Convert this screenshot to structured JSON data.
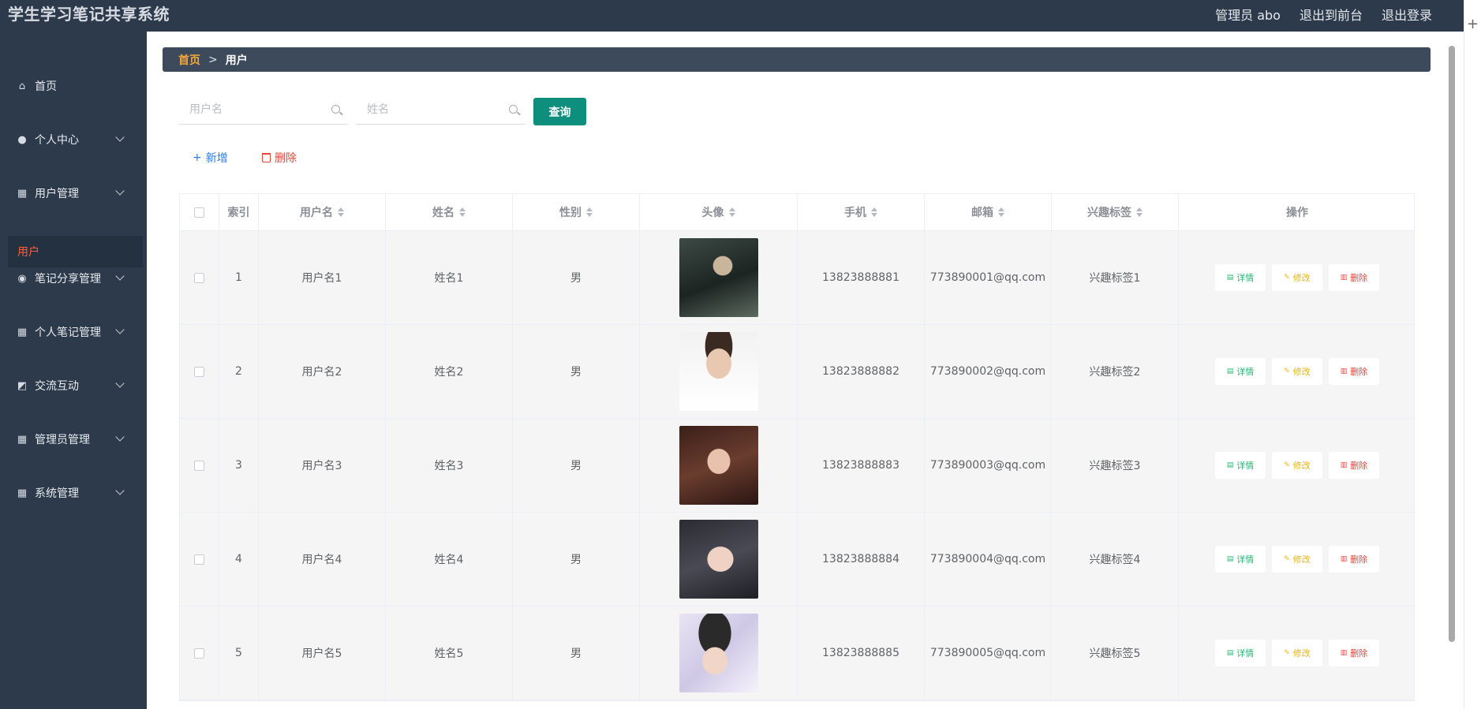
{
  "app": {
    "title": "学生学习笔记共享系统",
    "user_label": "管理员 abo",
    "to_front_label": "退出到前台",
    "logout_label": "退出登录"
  },
  "sidebar": {
    "items": [
      {
        "label": "首页",
        "icon": "home-icon",
        "has_children": false
      },
      {
        "label": "个人中心",
        "icon": "user-icon",
        "has_children": true
      },
      {
        "label": "用户管理",
        "icon": "grid-icon",
        "has_children": true
      },
      {
        "label": "笔记分享管理",
        "icon": "bulb-icon",
        "has_children": true
      },
      {
        "label": "个人笔记管理",
        "icon": "grid-icon",
        "has_children": true
      },
      {
        "label": "交流互动",
        "icon": "chart-icon",
        "has_children": true
      },
      {
        "label": "管理员管理",
        "icon": "grid-icon",
        "has_children": true
      },
      {
        "label": "系统管理",
        "icon": "grid-icon",
        "has_children": true
      }
    ],
    "active_sub": "用户"
  },
  "breadcrumb": {
    "home": "首页",
    "separator": ">",
    "current": "用户"
  },
  "search": {
    "username_placeholder": "用户名",
    "name_placeholder": "姓名",
    "query_label": "查询"
  },
  "actions": {
    "add_label": "新增",
    "delete_label": "删除"
  },
  "table": {
    "headers": [
      "索引",
      "用户名",
      "姓名",
      "性别",
      "头像",
      "手机",
      "邮箱",
      "兴趣标签",
      "操作"
    ],
    "rows": [
      {
        "index": "1",
        "username": "用户名1",
        "name": "姓名1",
        "sex": "男",
        "phone": "13823888881",
        "email": "773890001@qq.com",
        "tag": "兴趣标签1"
      },
      {
        "index": "2",
        "username": "用户名2",
        "name": "姓名2",
        "sex": "男",
        "phone": "13823888882",
        "email": "773890002@qq.com",
        "tag": "兴趣标签2"
      },
      {
        "index": "3",
        "username": "用户名3",
        "name": "姓名3",
        "sex": "男",
        "phone": "13823888883",
        "email": "773890003@qq.com",
        "tag": "兴趣标签3"
      },
      {
        "index": "4",
        "username": "用户名4",
        "name": "姓名4",
        "sex": "男",
        "phone": "13823888884",
        "email": "773890004@qq.com",
        "tag": "兴趣标签4"
      },
      {
        "index": "5",
        "username": "用户名5",
        "name": "姓名5",
        "sex": "男",
        "phone": "13823888885",
        "email": "773890005@qq.com",
        "tag": "兴趣标签5"
      }
    ],
    "op_labels": {
      "detail": "详情",
      "edit": "修改",
      "delete": "删除"
    }
  },
  "colors": {
    "sidebar_bg": "#2d3a4b",
    "accent_teal": "#0e8f7e",
    "breadcrumb_home": "#f3a83a",
    "active_sub": "#ff5f3a",
    "detail_green": "#2bb673",
    "edit_yellow": "#e6b422",
    "delete_red": "#e8443a"
  }
}
